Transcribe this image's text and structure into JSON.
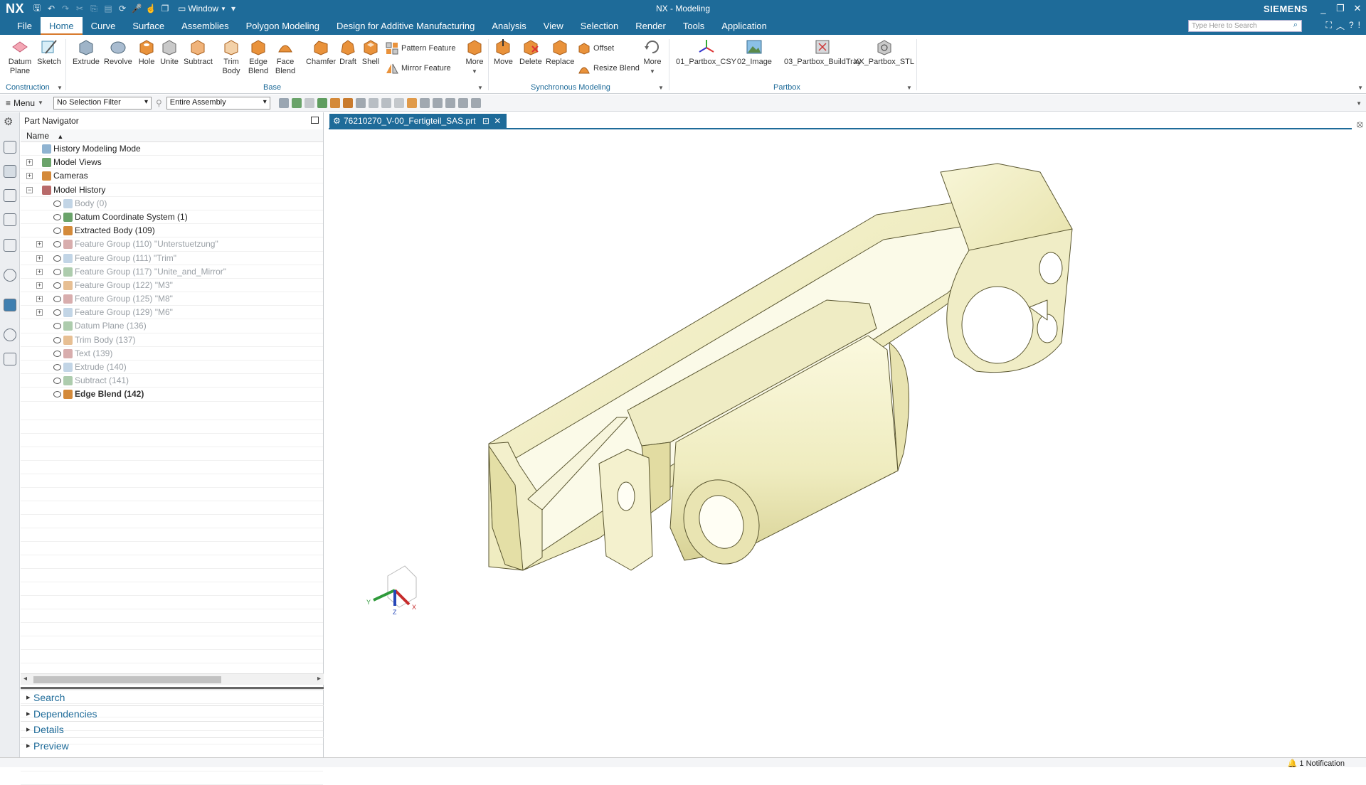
{
  "app": {
    "logo": "NX",
    "title": "NX - Modeling",
    "brand": "SIEMENS",
    "window_label": "Window"
  },
  "menu_tabs": [
    "File",
    "Home",
    "Curve",
    "Surface",
    "Assemblies",
    "Polygon Modeling",
    "Design for Additive Manufacturing",
    "Analysis",
    "View",
    "Selection",
    "Render",
    "Tools",
    "Application"
  ],
  "active_tab": "Home",
  "search": {
    "placeholder": "Type Here to Search"
  },
  "ribbon": {
    "construction": {
      "label": "Construction",
      "datum_plane": "Datum Plane",
      "sketch": "Sketch"
    },
    "base": {
      "label": "Base",
      "extrude": "Extrude",
      "revolve": "Revolve",
      "hole": "Hole",
      "unite": "Unite",
      "subtract": "Subtract",
      "trim_body": "Trim Body",
      "edge_blend": "Edge Blend",
      "face_blend": "Face Blend",
      "chamfer": "Chamfer",
      "draft": "Draft",
      "shell": "Shell",
      "pattern_feature": "Pattern Feature",
      "mirror_feature": "Mirror Feature",
      "more": "More"
    },
    "sync": {
      "label": "Synchronous Modeling",
      "move": "Move",
      "delete": "Delete",
      "replace": "Replace",
      "offset": "Offset",
      "resize_blend": "Resize Blend",
      "more": "More"
    },
    "partbox": {
      "label": "Partbox",
      "csy": "01_Partbox_CSY",
      "image": "02_Image",
      "buildtray": "03_Partbox_BuildTray",
      "stl": "XX_Partbox_STL"
    }
  },
  "selection_bar": {
    "menu": "Menu",
    "filter": "No Selection Filter",
    "scope": "Entire Assembly"
  },
  "navigator": {
    "title": "Part Navigator",
    "column": "Name",
    "rows": [
      {
        "label": "History Modeling Mode",
        "indent": 0,
        "expander": "",
        "state": "normal"
      },
      {
        "label": "Model Views",
        "indent": 0,
        "expander": "+",
        "state": "normal"
      },
      {
        "label": "Cameras",
        "indent": 0,
        "expander": "+",
        "state": "normal"
      },
      {
        "label": "Model History",
        "indent": 0,
        "expander": "-",
        "state": "normal"
      },
      {
        "label": "Body (0)",
        "indent": 1,
        "expander": "",
        "state": "dim"
      },
      {
        "label": "Datum Coordinate System (1)",
        "indent": 1,
        "expander": "",
        "state": "normal"
      },
      {
        "label": "Extracted Body (109)",
        "indent": 1,
        "expander": "",
        "state": "normal"
      },
      {
        "label": "Feature Group (110) \"Unterstuetzung\"",
        "indent": 1,
        "expander": "+",
        "state": "dim"
      },
      {
        "label": "Feature Group (111) \"Trim\"",
        "indent": 1,
        "expander": "+",
        "state": "dim"
      },
      {
        "label": "Feature Group (117) \"Unite_and_Mirror\"",
        "indent": 1,
        "expander": "+",
        "state": "dim"
      },
      {
        "label": "Feature Group (122) \"M3\"",
        "indent": 1,
        "expander": "+",
        "state": "dim"
      },
      {
        "label": "Feature Group (125) \"M8\"",
        "indent": 1,
        "expander": "+",
        "state": "dim"
      },
      {
        "label": "Feature Group (129) \"M6\"",
        "indent": 1,
        "expander": "+",
        "state": "dim"
      },
      {
        "label": "Datum Plane (136)",
        "indent": 1,
        "expander": "",
        "state": "dim"
      },
      {
        "label": "Trim Body (137)",
        "indent": 1,
        "expander": "",
        "state": "dim"
      },
      {
        "label": "Text (139)",
        "indent": 1,
        "expander": "",
        "state": "dim"
      },
      {
        "label": "Extrude (140)",
        "indent": 1,
        "expander": "",
        "state": "dim"
      },
      {
        "label": "Subtract (141)",
        "indent": 1,
        "expander": "",
        "state": "dim"
      },
      {
        "label": "Edge Blend (142)",
        "indent": 1,
        "expander": "",
        "state": "bold"
      }
    ],
    "panels": [
      "Search",
      "Dependencies",
      "Details",
      "Preview"
    ]
  },
  "document_tab": "76210270_V-00_Fertigteil_SAS.prt",
  "triad": {
    "x": "X",
    "y": "Y",
    "z": "Z"
  },
  "status": {
    "notification": "1 Notification"
  },
  "colors": {
    "header": "#1e6b99",
    "accent": "#d7792c",
    "part": "#f2efc4"
  }
}
